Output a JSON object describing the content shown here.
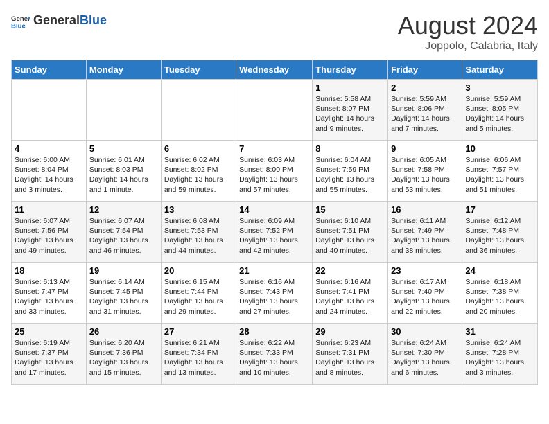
{
  "header": {
    "logo_general": "General",
    "logo_blue": "Blue",
    "title": "August 2024",
    "subtitle": "Joppolo, Calabria, Italy"
  },
  "weekdays": [
    "Sunday",
    "Monday",
    "Tuesday",
    "Wednesday",
    "Thursday",
    "Friday",
    "Saturday"
  ],
  "weeks": [
    [
      {
        "day": "",
        "info": ""
      },
      {
        "day": "",
        "info": ""
      },
      {
        "day": "",
        "info": ""
      },
      {
        "day": "",
        "info": ""
      },
      {
        "day": "1",
        "info": "Sunrise: 5:58 AM\nSunset: 8:07 PM\nDaylight: 14 hours\nand 9 minutes."
      },
      {
        "day": "2",
        "info": "Sunrise: 5:59 AM\nSunset: 8:06 PM\nDaylight: 14 hours\nand 7 minutes."
      },
      {
        "day": "3",
        "info": "Sunrise: 5:59 AM\nSunset: 8:05 PM\nDaylight: 14 hours\nand 5 minutes."
      }
    ],
    [
      {
        "day": "4",
        "info": "Sunrise: 6:00 AM\nSunset: 8:04 PM\nDaylight: 14 hours\nand 3 minutes."
      },
      {
        "day": "5",
        "info": "Sunrise: 6:01 AM\nSunset: 8:03 PM\nDaylight: 14 hours\nand 1 minute."
      },
      {
        "day": "6",
        "info": "Sunrise: 6:02 AM\nSunset: 8:02 PM\nDaylight: 13 hours\nand 59 minutes."
      },
      {
        "day": "7",
        "info": "Sunrise: 6:03 AM\nSunset: 8:00 PM\nDaylight: 13 hours\nand 57 minutes."
      },
      {
        "day": "8",
        "info": "Sunrise: 6:04 AM\nSunset: 7:59 PM\nDaylight: 13 hours\nand 55 minutes."
      },
      {
        "day": "9",
        "info": "Sunrise: 6:05 AM\nSunset: 7:58 PM\nDaylight: 13 hours\nand 53 minutes."
      },
      {
        "day": "10",
        "info": "Sunrise: 6:06 AM\nSunset: 7:57 PM\nDaylight: 13 hours\nand 51 minutes."
      }
    ],
    [
      {
        "day": "11",
        "info": "Sunrise: 6:07 AM\nSunset: 7:56 PM\nDaylight: 13 hours\nand 49 minutes."
      },
      {
        "day": "12",
        "info": "Sunrise: 6:07 AM\nSunset: 7:54 PM\nDaylight: 13 hours\nand 46 minutes."
      },
      {
        "day": "13",
        "info": "Sunrise: 6:08 AM\nSunset: 7:53 PM\nDaylight: 13 hours\nand 44 minutes."
      },
      {
        "day": "14",
        "info": "Sunrise: 6:09 AM\nSunset: 7:52 PM\nDaylight: 13 hours\nand 42 minutes."
      },
      {
        "day": "15",
        "info": "Sunrise: 6:10 AM\nSunset: 7:51 PM\nDaylight: 13 hours\nand 40 minutes."
      },
      {
        "day": "16",
        "info": "Sunrise: 6:11 AM\nSunset: 7:49 PM\nDaylight: 13 hours\nand 38 minutes."
      },
      {
        "day": "17",
        "info": "Sunrise: 6:12 AM\nSunset: 7:48 PM\nDaylight: 13 hours\nand 36 minutes."
      }
    ],
    [
      {
        "day": "18",
        "info": "Sunrise: 6:13 AM\nSunset: 7:47 PM\nDaylight: 13 hours\nand 33 minutes."
      },
      {
        "day": "19",
        "info": "Sunrise: 6:14 AM\nSunset: 7:45 PM\nDaylight: 13 hours\nand 31 minutes."
      },
      {
        "day": "20",
        "info": "Sunrise: 6:15 AM\nSunset: 7:44 PM\nDaylight: 13 hours\nand 29 minutes."
      },
      {
        "day": "21",
        "info": "Sunrise: 6:16 AM\nSunset: 7:43 PM\nDaylight: 13 hours\nand 27 minutes."
      },
      {
        "day": "22",
        "info": "Sunrise: 6:16 AM\nSunset: 7:41 PM\nDaylight: 13 hours\nand 24 minutes."
      },
      {
        "day": "23",
        "info": "Sunrise: 6:17 AM\nSunset: 7:40 PM\nDaylight: 13 hours\nand 22 minutes."
      },
      {
        "day": "24",
        "info": "Sunrise: 6:18 AM\nSunset: 7:38 PM\nDaylight: 13 hours\nand 20 minutes."
      }
    ],
    [
      {
        "day": "25",
        "info": "Sunrise: 6:19 AM\nSunset: 7:37 PM\nDaylight: 13 hours\nand 17 minutes."
      },
      {
        "day": "26",
        "info": "Sunrise: 6:20 AM\nSunset: 7:36 PM\nDaylight: 13 hours\nand 15 minutes."
      },
      {
        "day": "27",
        "info": "Sunrise: 6:21 AM\nSunset: 7:34 PM\nDaylight: 13 hours\nand 13 minutes."
      },
      {
        "day": "28",
        "info": "Sunrise: 6:22 AM\nSunset: 7:33 PM\nDaylight: 13 hours\nand 10 minutes."
      },
      {
        "day": "29",
        "info": "Sunrise: 6:23 AM\nSunset: 7:31 PM\nDaylight: 13 hours\nand 8 minutes."
      },
      {
        "day": "30",
        "info": "Sunrise: 6:24 AM\nSunset: 7:30 PM\nDaylight: 13 hours\nand 6 minutes."
      },
      {
        "day": "31",
        "info": "Sunrise: 6:24 AM\nSunset: 7:28 PM\nDaylight: 13 hours\nand 3 minutes."
      }
    ]
  ]
}
